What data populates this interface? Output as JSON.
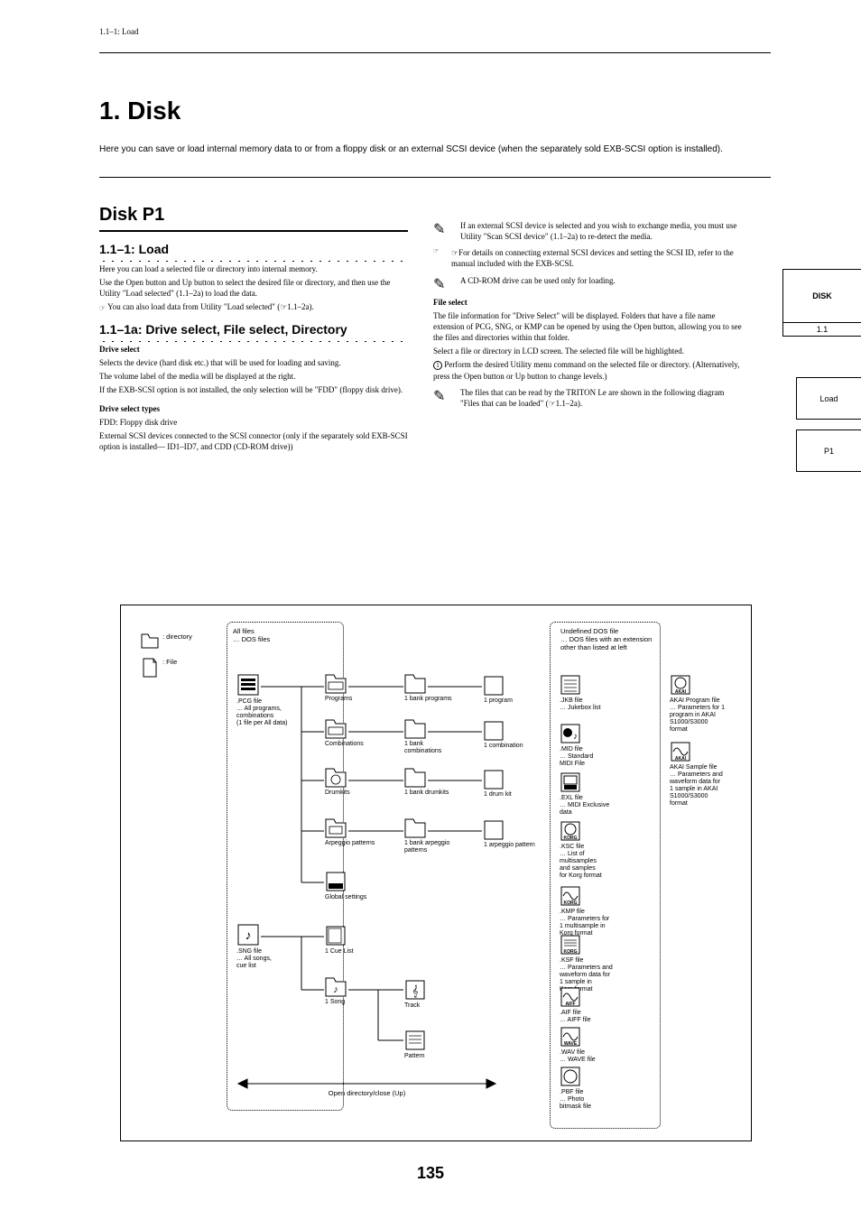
{
  "page_header": "1.1–1: Load",
  "title": "1. Disk",
  "subtitle": "Here you can save or load internal memory data to or from a floppy disk or an external SCSI device (when the separately sold EXB-SCSI option is installed).",
  "side_tab_main": "DISK",
  "side_tabs": [
    "1.1"
  ],
  "right_tabs": [
    "Load",
    "P1"
  ],
  "colL": {
    "h2": "Disk P1",
    "h3a": "1.1–1: Load",
    "p1a": "Here you can load a selected file or directory into internal memory.",
    "p1b": "Use the Open button and Up button to select the desired file or directory, and then use the Utility \"Load selected\" (1.1–2a) to load the data.",
    "p1c": "You can also load data from Utility \"Load selected\" (☞1.1–2a).",
    "h3b": "1.1–1a: Drive select, File select, Directory",
    "d1": "Drive select",
    "d1t": "Selects the device (hard disk etc.) that will be used for loading and saving.",
    "d1t2": "The volume label of the media will be displayed at the right.",
    "d1t3": "If the EXB-SCSI option is not installed, the only selection will be \"FDD\" (floppy disk drive).",
    "d2": "Drive select types",
    "d2t": "FDD: Floppy disk drive",
    "ext": "External SCSI devices connected to the SCSI connector (only if the separately sold EXB-SCSI option is installed— ID1–ID7, and CDD (CD-ROM drive))"
  },
  "colR": {
    "n1": "If an external SCSI device is selected and you wish to exchange media, you must use Utility \"Scan SCSI device\" (1.1–2a) to re-detect the media.",
    "n1ref": "☞For details on connecting external SCSI devices and setting the SCSI ID, refer to the manual included with the EXB-SCSI.",
    "n2": "A CD-ROM drive can be used only for loading.",
    "fs": "File select",
    "fst": "The file information for \"Drive Select\" will be displayed. Folders that have a file name extension of PCG, SNG, or KMP can be opened by using the Open button, allowing you to see the files and directories within that folder.",
    "fst2": "Select a file or directory in LCD screen. The selected file will be highlighted.",
    "num1": "Perform the desired Utility menu command on the selected file or directory. (Alternatively, press the Open button or Up button to change levels.)",
    "n3": "The files that can be read by the TRITON Le are shown in the following diagram \"Files that can be loaded\" (☞1.1–2a)."
  },
  "diagram": {
    "legend_dir": ": directory",
    "legend_file": ": File",
    "box1_label": "All files\n… DOS files",
    "box2_label": "Undefined DOS file\n… DOS files with an extension\nother than listed at left",
    "arrow_label": "Open directory/close (Up)",
    "nodes": {
      "pcg": ".PCG file\n… All programs,\ncombinations\n(1 file per All data)",
      "sng": ".SNG file\n… All songs,\ncue list",
      "prog_dir": "Programs",
      "combi_dir": "Combinations",
      "drum_dir": "Drumkits",
      "arp_dir": "Arpeggio patterns",
      "global": "Global settings",
      "cue": "1 Cue List",
      "song_dir": "1 Song",
      "prog_bank": "1 bank programs",
      "combi_bank": "1 bank combinations",
      "drum_bank": "1 bank drumkits",
      "arp_bank": "1 bank arpeggio patterns",
      "prog1": "1 program",
      "combi1": "1 combination",
      "drum1": "1 drum kit",
      "arp1": "1 arpeggio pattern",
      "track": "Track",
      "pattern": "Pattern",
      "jkb": ".JKB file\n… Jukebox list",
      "mid": ".MID file\n… Standard\nMIDI File",
      "exl": ".EXL file\n… MIDI Exclusive\ndata",
      "ksc": ".KSC file\n… List of\nmultisamples\nand samples\nfor Korg format",
      "kmp": ".KMP file\n… Parameters for\n1 multisample in\nKorg format",
      "ksf": ".KSF file\n… Parameters and\nwaveform data for\n1 sample in\nKorg format",
      "aif": ".AIF file\n… AIFF file",
      "wav": ".WAV file\n… WAVE file",
      "pbf": ".PBF file\n… Photo\nbitmask file",
      "akai_p": "AKAI Program file\n… Parameters for 1\nprogram in AKAI\nS1000/S3000\nformat",
      "akai_s": "AKAI Sample file\n… Parameters and\nwaveform data for\n1 sample in AKAI\nS1000/S3000\nformat"
    }
  },
  "footer": "135"
}
